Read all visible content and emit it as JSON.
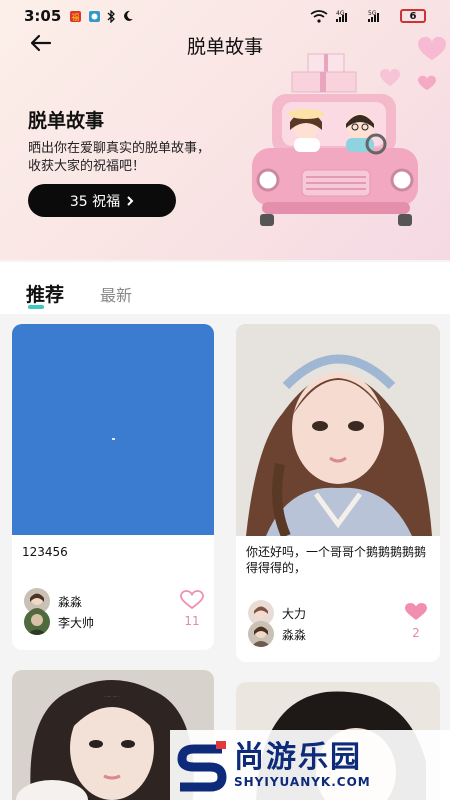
{
  "status": {
    "time": "3:05",
    "battery": "6",
    "net1": "4G",
    "net2": "5G"
  },
  "nav": {
    "title": "脱单故事"
  },
  "hero": {
    "title": "脱单故事",
    "desc": "晒出你在爱聊真实的脱单故事，收获大家的祝福吧！",
    "button_label": "35 祝福"
  },
  "tabs": [
    {
      "label": "推荐"
    },
    {
      "label": "最新"
    }
  ],
  "posts": [
    {
      "text": "123456",
      "authors": [
        "淼淼",
        "李大帅"
      ],
      "likes": "11",
      "liked": false
    },
    {
      "text": "你还好吗，一个哥哥个鹅鹅鹅鹅鹅得得得的，",
      "authors": [
        "大力",
        "淼淼"
      ],
      "likes": "2",
      "liked": true
    }
  ],
  "watermark": {
    "cn": "尚游乐园",
    "en": "SHYIYUANYK.COM"
  },
  "colors": {
    "accent": "#3fc7c2",
    "heart": "#f28fb1",
    "dark_button": "#0b0b0b"
  }
}
